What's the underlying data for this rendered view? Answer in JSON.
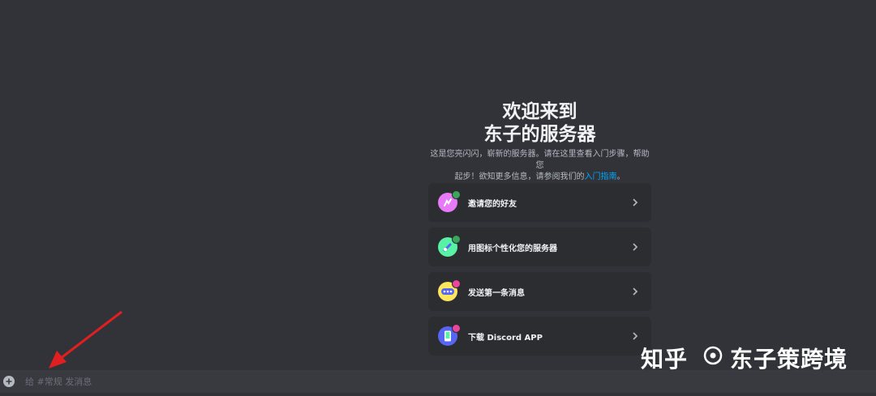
{
  "welcome": {
    "title_line1": "欢迎来到",
    "title_line2": "东子的服务器",
    "desc_line1": "这是您亮闪闪，崭新的服务器。请在这里查看入门步骤，帮助您",
    "desc_line2_prefix": "起步！欲知更多信息，请参阅我们的",
    "desc_link": "入门指南",
    "desc_suffix": "。"
  },
  "cards": [
    {
      "label": "邀请您的好友",
      "icon": "invite-friends-icon",
      "color": "#e879f9",
      "badge": "#3ba55c"
    },
    {
      "label": "用图标个性化您的服务器",
      "icon": "paintbrush-icon",
      "color": "#57f2a5",
      "badge": "#3ba55c"
    },
    {
      "label": "发送第一条消息",
      "icon": "chat-bubble-icon",
      "color": "#fee75c",
      "badge": "#eb459e"
    },
    {
      "label": "下载 Discord APP",
      "icon": "mobile-app-icon",
      "color": "#5865f2",
      "badge": "#eb459e"
    }
  ],
  "composer": {
    "placeholder": "给 #常规 发消息"
  },
  "watermark": {
    "site": "知乎",
    "author": "东子策跨境"
  },
  "colors": {
    "background": "#313338",
    "card": "#2b2d31",
    "link": "#00a8fc",
    "annotation_arrow": "#e02020"
  }
}
